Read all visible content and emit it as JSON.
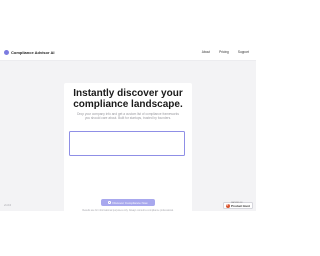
{
  "navbar": {
    "brand_name": "Compliance Advisor AI",
    "links": [
      "About",
      "Pricing",
      "Support"
    ]
  },
  "hero": {
    "headline": "Instantly discover your compliance landscape.",
    "subtext": "Drop your company info and get a custom list of compliance frameworks you should care about. Built for startups, trusted by founders.",
    "input_value": "",
    "input_placeholder": "",
    "cta_label": "Discover Compliance Now",
    "note": "Results are for informational purposes only. Always consult a compliance professional."
  },
  "footer": {
    "version_text": "v1.0.0",
    "badge_small": "FEATURED ON",
    "badge_big": "Product Hunt",
    "badge_icon_letter": "P"
  },
  "colors": {
    "accent": "#8f8fe6",
    "button": "#a8a8ee",
    "background": "#f3f3f5",
    "product_hunt": "#da552f"
  }
}
